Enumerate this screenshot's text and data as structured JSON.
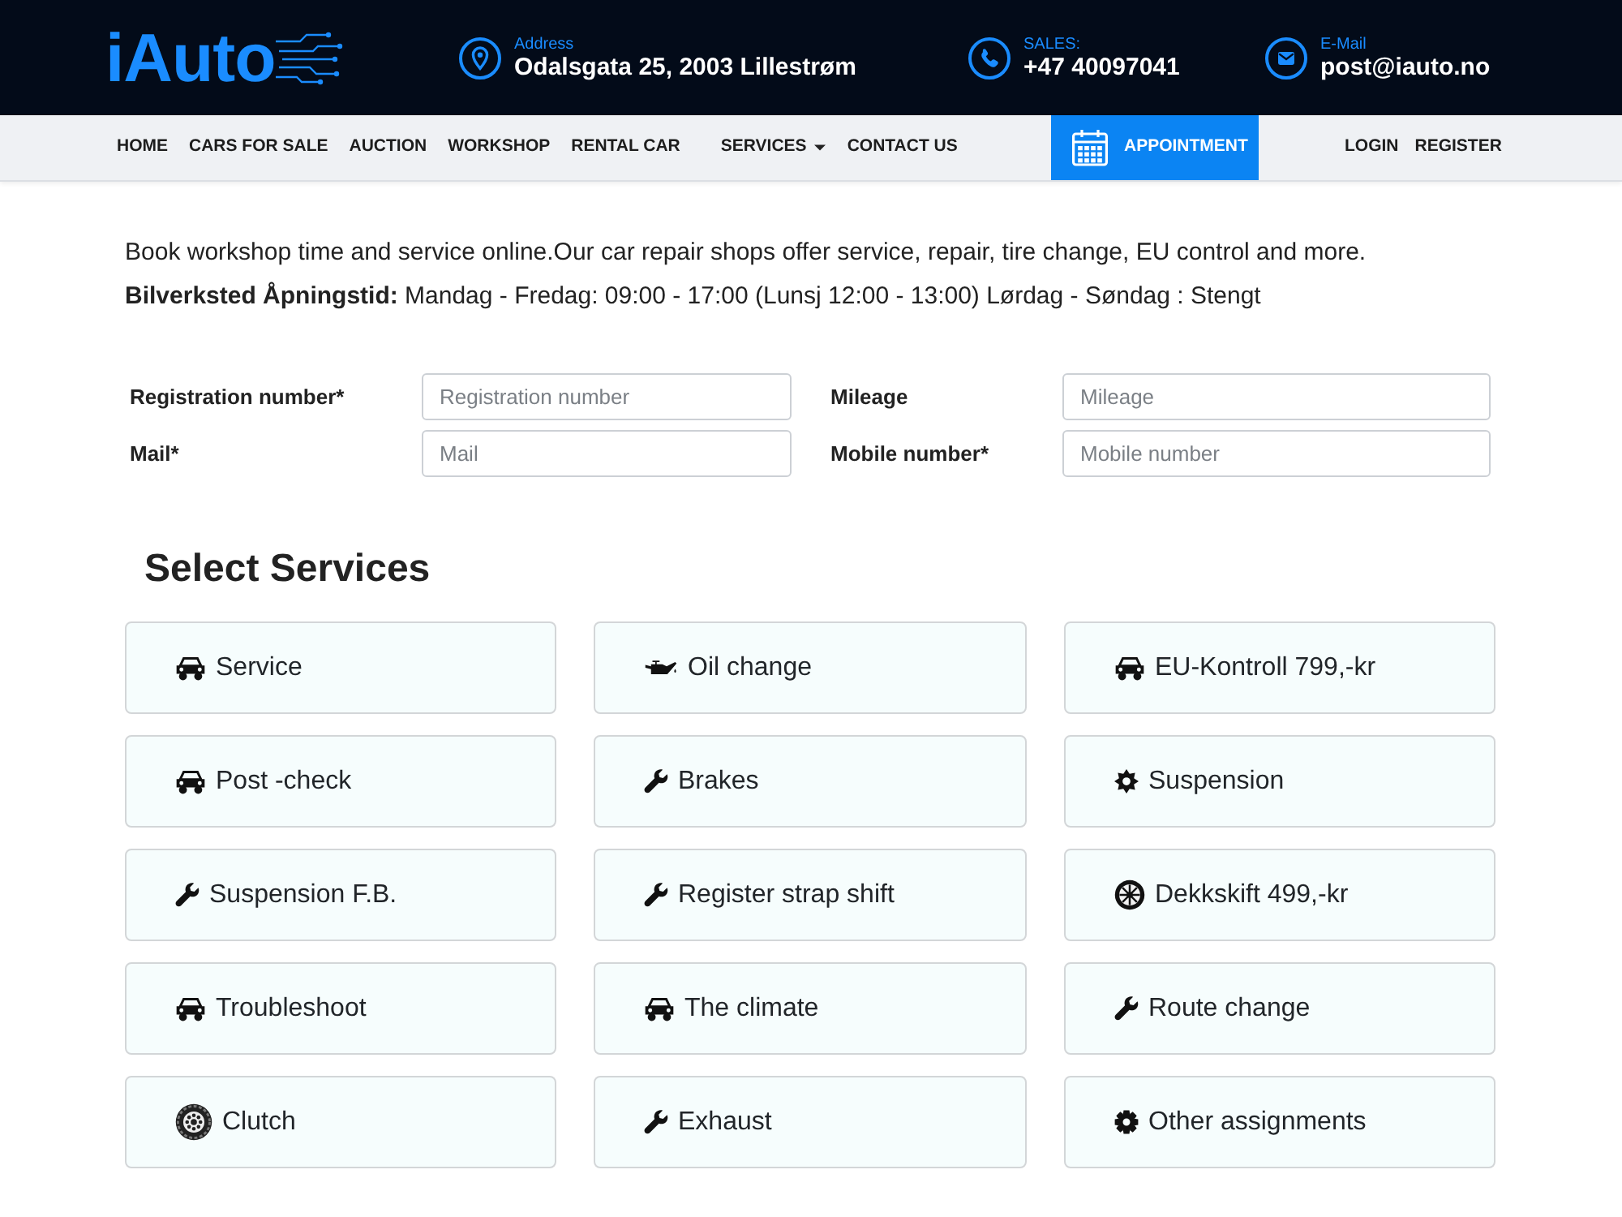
{
  "header": {
    "logo": "iAuto",
    "contacts": [
      {
        "kind": "address",
        "label": "Address",
        "value": "Odalsgata 25, 2003 Lillestrøm"
      },
      {
        "kind": "phone",
        "label": "SALES:",
        "value": "+47 40097041"
      },
      {
        "kind": "email",
        "label": "E-Mail",
        "value": "post@iauto.no"
      }
    ]
  },
  "nav": {
    "items": [
      {
        "label": "HOME",
        "kind": "link"
      },
      {
        "label": "CARS FOR SALE",
        "kind": "link"
      },
      {
        "label": "AUCTION",
        "kind": "link"
      },
      {
        "label": "WORKSHOP",
        "kind": "link"
      },
      {
        "label": "RENTAL CAR",
        "kind": "link"
      },
      {
        "label": "SERVICES",
        "kind": "dropdown"
      },
      {
        "label": "CONTACT US",
        "kind": "link"
      }
    ],
    "appointment": "APPOINTMENT",
    "account_links": [
      "LOGIN",
      "REGISTER"
    ]
  },
  "intro": {
    "text": "Book workshop time and service online.Our car repair shops offer service, repair, tire change, EU control and more.",
    "hours": "**Bilverksted Åpningstid:** Mandag - Fredag: 09:00 - 17:00 (Lunsj 12:00 - 13:00) Lørdag - Søndag : Stengt"
  },
  "form": {
    "fields": [
      {
        "label": "Registration number*",
        "placeholder": "Registration number"
      },
      {
        "label": "Mileage",
        "placeholder": "Mileage"
      },
      {
        "label": "Mail*",
        "placeholder": "Mail"
      },
      {
        "label": "Mobile number*",
        "placeholder": "Mobile number"
      }
    ]
  },
  "services": {
    "title": "Select Services",
    "items": [
      {
        "label": "Service",
        "kind": "car",
        "selected": false
      },
      {
        "label": "Oil change",
        "kind": "oil_can",
        "selected": false
      },
      {
        "label": "EU-Kontroll 799,-kr",
        "kind": "car",
        "selected": false
      },
      {
        "label": "Post -check",
        "kind": "car",
        "selected": false
      },
      {
        "label": "Brakes",
        "kind": "wrench",
        "selected": false
      },
      {
        "label": "Suspension",
        "kind": "spiked_gear",
        "selected": false
      },
      {
        "label": "Suspension F.B.",
        "kind": "wrench",
        "selected": false
      },
      {
        "label": "Register strap shift",
        "kind": "wrench",
        "selected": false
      },
      {
        "label": "Dekkskift 499,-kr",
        "kind": "wheel",
        "selected": false
      },
      {
        "label": "Troubleshoot",
        "kind": "car",
        "selected": false
      },
      {
        "label": "The climate",
        "kind": "car",
        "selected": false
      },
      {
        "label": "Route change",
        "kind": "wrench",
        "selected": false
      },
      {
        "label": "Clutch",
        "kind": "tire",
        "selected": false
      },
      {
        "label": "Exhaust",
        "kind": "wrench",
        "selected": false
      },
      {
        "label": "Other assignments",
        "kind": "gear",
        "selected": false
      }
    ]
  }
}
